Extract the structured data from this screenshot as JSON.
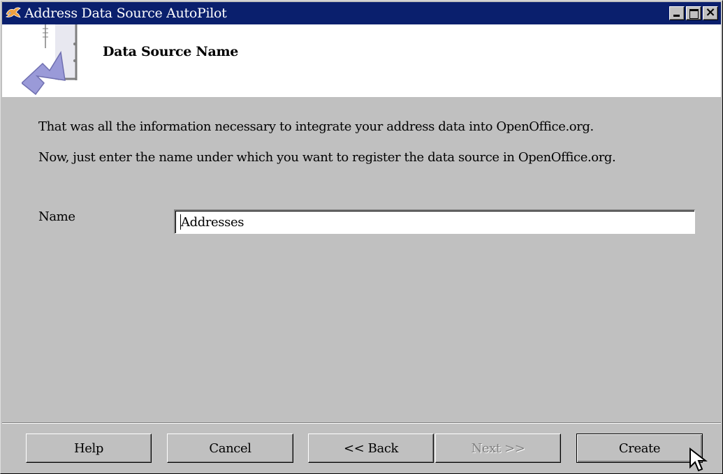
{
  "window": {
    "title": "Address Data Source AutoPilot"
  },
  "header": {
    "title": "Data Source Name"
  },
  "body": {
    "line1": "That was all the information necessary to integrate your address data into OpenOffice.org.",
    "line2": "Now, just enter the name under which you want to register the data source in OpenOffice.org.",
    "name_label": "Name",
    "name_value": "Addresses"
  },
  "buttons": {
    "help": "Help",
    "cancel": "Cancel",
    "back": "<< Back",
    "next": "Next >>",
    "create": "Create"
  },
  "colors": {
    "titlebar": "#0a1f6d",
    "dialog": "#c0c0c0",
    "header_band": "#ffffff"
  }
}
